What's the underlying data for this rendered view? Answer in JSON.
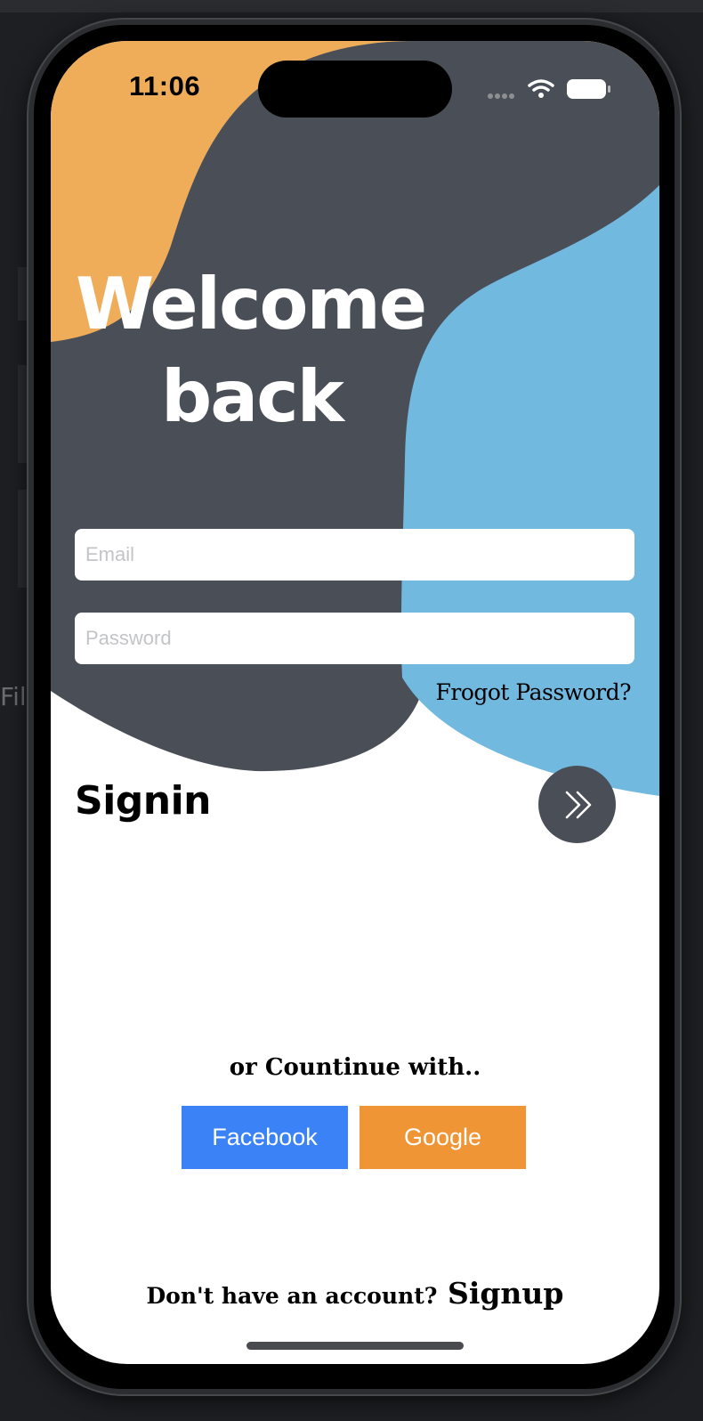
{
  "colors": {
    "orange_shape": "#efad5a",
    "dark_shape": "#4a4f57",
    "blue_shape": "#72b9e0",
    "facebook": "#3b82f6",
    "google": "#ef9535",
    "signin_button": "#4a4f57"
  },
  "background_app": {
    "side_label": "Fil"
  },
  "status_bar": {
    "time": "11:06",
    "icons": [
      "cellular-dots-icon",
      "wifi-icon",
      "battery-icon"
    ]
  },
  "welcome": {
    "line1": "Welcome",
    "line2": "back"
  },
  "form": {
    "email_placeholder": "Email",
    "password_placeholder": "Password",
    "forgot_label": "Frogot Password?"
  },
  "signin": {
    "label": "Signin",
    "button_icon": "double-chevron-right-icon"
  },
  "social": {
    "prompt": "or Countinue with..",
    "facebook_label": "Facebook",
    "google_label": "Google"
  },
  "footer": {
    "question": "Don't have an account?",
    "signup_label": "Signup"
  }
}
